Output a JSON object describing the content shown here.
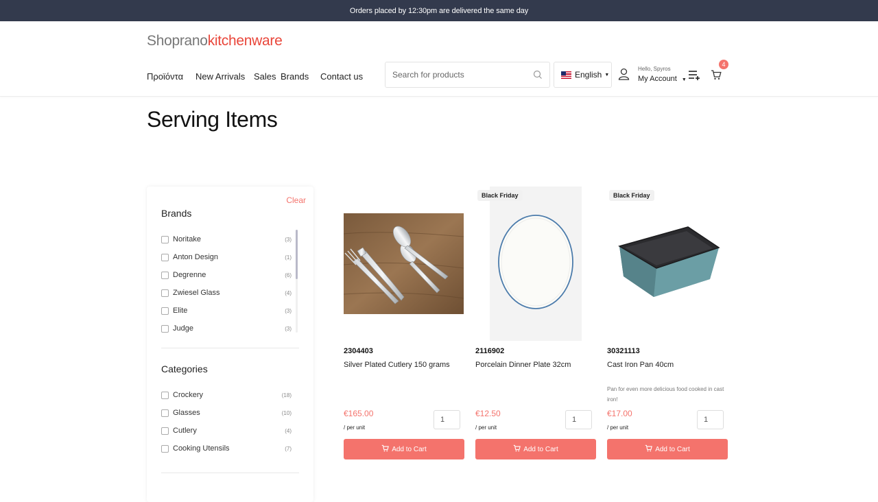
{
  "topbar": {
    "text": "Orders placed by 12:30pm are delivered the same day"
  },
  "logo": {
    "part1": "Shoprano",
    "part2": "kitchenware"
  },
  "nav": [
    "Προϊόντα",
    "New Arrivals",
    "Sales",
    "Brands",
    "Contact us"
  ],
  "search": {
    "placeholder": "Search for products"
  },
  "language": {
    "label": "English"
  },
  "account": {
    "greeting": "Hello, Spyros",
    "label": "My Account"
  },
  "cart": {
    "count": "4"
  },
  "page_title": "Serving Items",
  "filters": {
    "clear_label": "Clear",
    "brands_title": "Brands",
    "brands": [
      {
        "name": "Noritake",
        "count": "(3)"
      },
      {
        "name": "Anton Design",
        "count": "(1)"
      },
      {
        "name": "Degrenne",
        "count": "(6)"
      },
      {
        "name": "Zwiesel Glass",
        "count": "(4)"
      },
      {
        "name": "Elite",
        "count": "(3)"
      },
      {
        "name": "Judge",
        "count": "(3)"
      }
    ],
    "categories_title": "Categories",
    "categories": [
      {
        "name": "Crockery",
        "count": "(18)"
      },
      {
        "name": "Glasses",
        "count": "(10)"
      },
      {
        "name": "Cutlery",
        "count": "(4)"
      },
      {
        "name": "Cooking Utensils",
        "count": "(7)"
      }
    ]
  },
  "products": [
    {
      "tag": "",
      "sku": "2304403",
      "name": "Silver Plated Cutlery 150 grams",
      "description": "",
      "price": "€165.00",
      "unit": "/ per unit",
      "qty": "1",
      "button": "Add to Cart"
    },
    {
      "tag": "Black Friday",
      "sku": "2116902",
      "name": "Porcelain Dinner Plate 32cm",
      "description": "",
      "price": "€12.50",
      "unit": "/ per unit",
      "qty": "1",
      "button": "Add to Cart"
    },
    {
      "tag": "Black Friday",
      "sku": "30321113",
      "name": "Cast Iron Pan 40cm",
      "description": "Pan for even more delicious food cooked in cast iron!",
      "price": "€17.00",
      "unit": "/ per unit",
      "qty": "1",
      "button": "Add to Cart"
    }
  ],
  "colors": {
    "topbar": "#333a4d",
    "accent": "#f4736c",
    "logo_accent": "#e9463a"
  }
}
